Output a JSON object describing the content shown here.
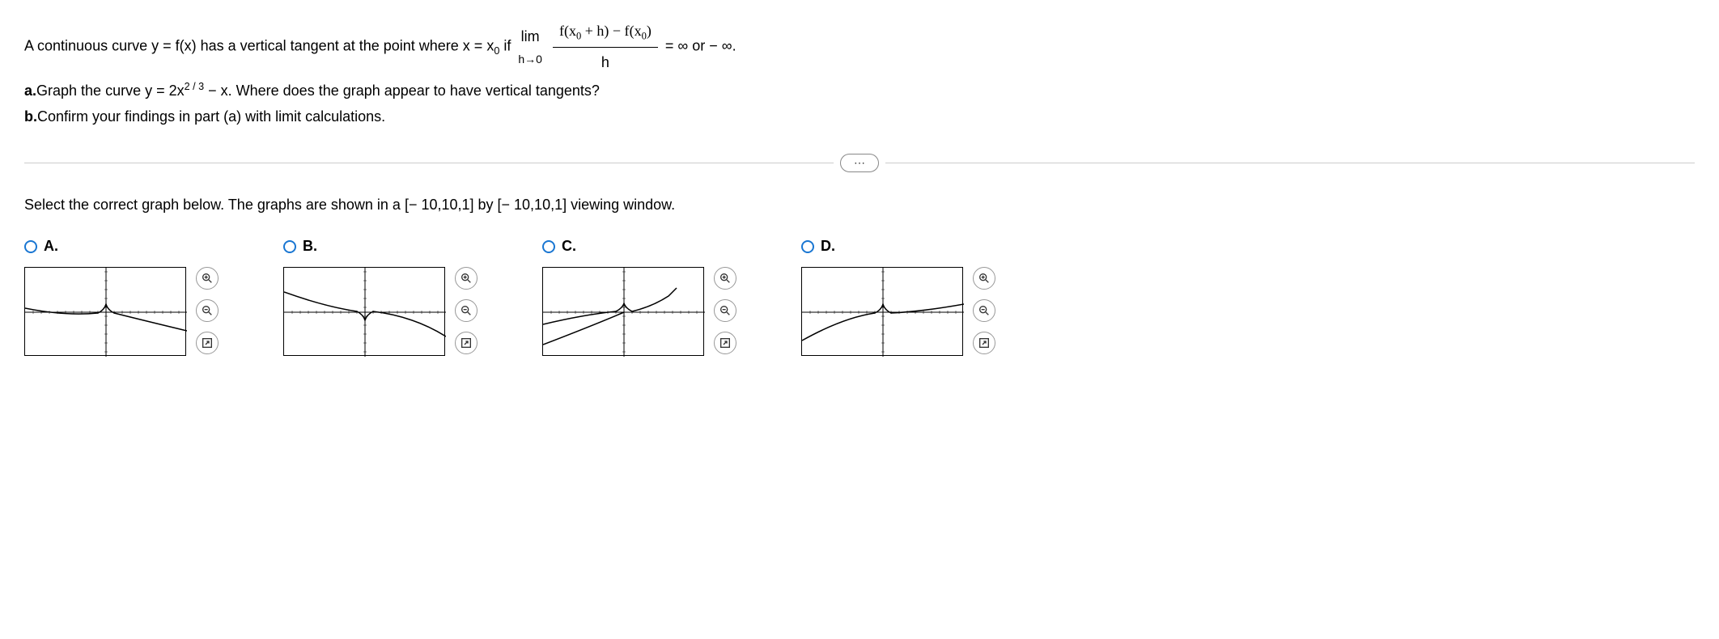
{
  "problem": {
    "intro_a": "A continuous curve y = f(x) has a vertical tangent at the point where x = x",
    "intro_b": " if ",
    "lim_label": "lim",
    "lim_approach": "h→0",
    "frac_num": "f(x₀ + h) − f(x₀)",
    "frac_den": "h",
    "intro_c": " = ∞ or − ∞.",
    "part_a_label": "a.",
    "part_a_text_1": "Graph the curve y = 2x",
    "part_a_exp": "2 / 3",
    "part_a_text_2": " − x. Where does the graph appear to have vertical tangents?",
    "part_b_label": "b.",
    "part_b_text": "Confirm your findings in part (a) with limit calculations."
  },
  "dots": "⋯",
  "prompt": "Select the correct graph below. The graphs are shown in a [− 10,10,1] by [− 10,10,1] viewing window.",
  "options": [
    {
      "label": "A.",
      "shape": "a"
    },
    {
      "label": "B.",
      "shape": "b"
    },
    {
      "label": "C.",
      "shape": "c"
    },
    {
      "label": "D.",
      "shape": "d"
    }
  ]
}
